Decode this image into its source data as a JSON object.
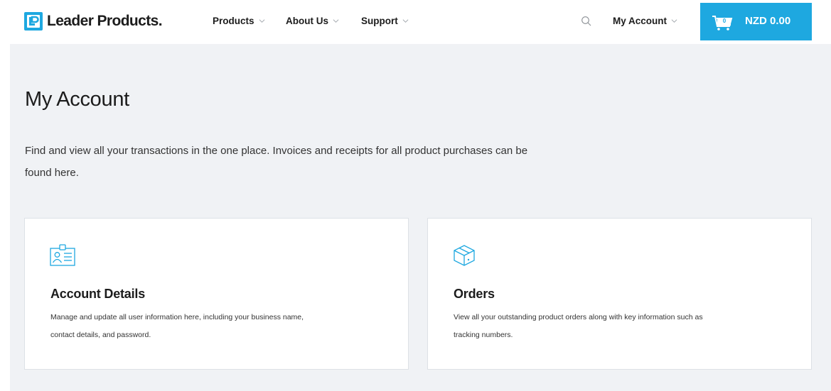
{
  "header": {
    "logo_text": "Leader Products.",
    "nav": {
      "products": "Products",
      "about": "About Us",
      "support": "Support"
    },
    "account": "My Account",
    "cart": {
      "count": "0",
      "total": "NZD 0.00"
    }
  },
  "main": {
    "title": "My Account",
    "intro": "Find and view all your transactions in the one place. Invoices and receipts for all product purchases can be found here."
  },
  "cards": [
    {
      "icon": "id-card-icon",
      "title": "Account Details",
      "description": "Manage and update all user information here, including your business name, contact details, and password."
    },
    {
      "icon": "box-icon",
      "title": "Orders",
      "description": "View all your outstanding product orders along with key information such as tracking numbers."
    }
  ],
  "colors": {
    "accent": "#1ea8e0",
    "background": "#f0f2f5",
    "text": "#1c1c1c"
  }
}
